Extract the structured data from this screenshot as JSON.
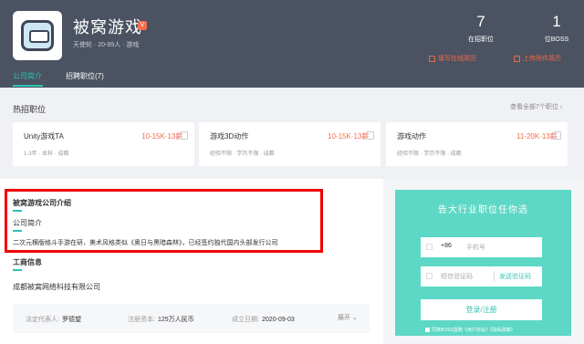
{
  "company": {
    "name": "被窝游戏",
    "verified_badge": "V",
    "meta": "天使轮 · 20-99人 · 游戏"
  },
  "stats": [
    {
      "value": "7",
      "label": "在招职位"
    },
    {
      "value": "1",
      "label": "位BOSS"
    }
  ],
  "actions": {
    "fill_resume": "填写在线简历",
    "upload_resume": "上传附件简历"
  },
  "tabs": [
    {
      "label": "公司简介",
      "active": true
    },
    {
      "label": "招聘职位(7)",
      "active": false
    }
  ],
  "hot_jobs": {
    "title": "热招职位",
    "view_all": "查看全部7个职位 ›",
    "jobs": [
      {
        "title": "Unity游戏TA",
        "salary": "10-15K·13薪",
        "meta": "1-3年 · 本科 · 成都"
      },
      {
        "title": "游戏3D动作",
        "salary": "10-15K·13薪",
        "meta": "经验不限 · 学历不限 · 成都"
      },
      {
        "title": "游戏动作",
        "salary": "11-20K·13薪",
        "meta": "经验不限 · 学历不限 · 成都"
      }
    ]
  },
  "intro": {
    "title": "被窝游戏公司介绍",
    "subtitle": "公司简介",
    "text": "二次元横版格斗手游在研，美术风格类似《奥日与黑暗森林》，已经签约独代国内头部发行公司"
  },
  "business": {
    "title": "工商信息",
    "company_name": "成都被窝网络科技有限公司",
    "fields": [
      {
        "key": "法定代表人:",
        "value": "罗德望"
      },
      {
        "key": "注册资本:",
        "value": "125万人民币"
      },
      {
        "key": "成立日期:",
        "value": "2020-09-03"
      }
    ],
    "expand": "展开"
  },
  "login": {
    "title": "告大行业职位任你选",
    "country_code": "+86",
    "phone_placeholder": "手机号",
    "code_placeholder": "短信验证码",
    "send_code": "发送验证码",
    "submit": "登录/注册",
    "agreement": "同意BOSS直聘《用户协议》《隐私政策》"
  },
  "colors": {
    "header_bg": "#4b5261",
    "accent_teal": "#25c6b6",
    "salary_orange": "#f26d4f",
    "login_panel": "#5dd8c6"
  }
}
